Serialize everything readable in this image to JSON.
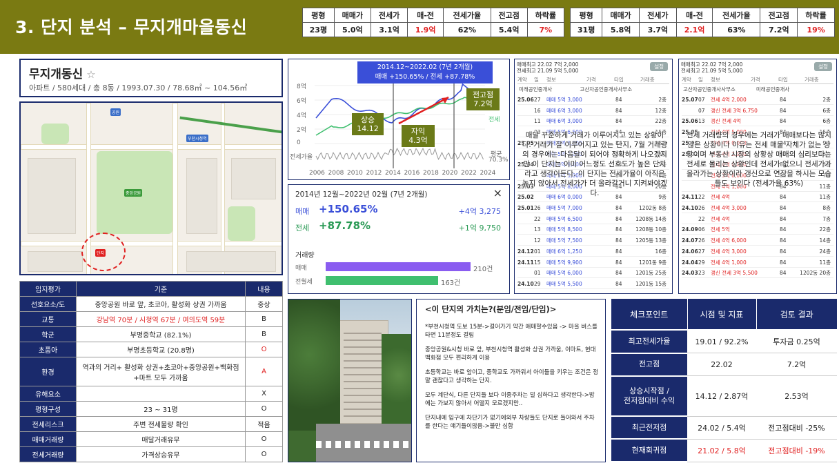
{
  "header": {
    "title": "3. 단지 분석 – 무지개마을동신"
  },
  "pyeong_tables": [
    {
      "headers": [
        "평형",
        "매매가",
        "전세가",
        "매-전",
        "전세가율",
        "전고점",
        "하락률"
      ],
      "values": [
        "23평",
        "5.0억",
        "3.1억",
        "1.9억",
        "62%",
        "5.4억",
        "7%"
      ]
    },
    {
      "headers": [
        "평형",
        "매매가",
        "전세가",
        "매-전",
        "전세가율",
        "전고점",
        "하락률"
      ],
      "values": [
        "31평",
        "5.8억",
        "3.7억",
        "2.1억",
        "63%",
        "7.2억",
        "19%"
      ]
    }
  ],
  "complex": {
    "name": "무지개동신",
    "star": "☆",
    "info": "아파트 / 580세대 / 총 8동 / 1993.07.30 / 78.68㎡ ~ 104.56㎡"
  },
  "evaluation": {
    "headers": [
      "입지평가",
      "기준",
      "내용"
    ],
    "rows": [
      {
        "k": "선호요소/도",
        "v": "중앙공원 바로 앞, 초코아, 활성화 상권 가까움",
        "r": "중상",
        "red": false
      },
      {
        "k": "교통",
        "v": "강남역 70분 / 시청역 67분 / 여의도역 59분",
        "r": "B",
        "red": true
      },
      {
        "k": "학군",
        "v": "부명중학교 (82.1%)",
        "r": "B",
        "red": false
      },
      {
        "k": "초품아",
        "v": "부명초등학교 (20.8명)",
        "r": "O",
        "red": false,
        "rred": true
      },
      {
        "k": "환경",
        "v": "역과의 거리+ 활성화 상권+초코아+중앙공원+백화점+마트 모두 가까움",
        "r": "A",
        "red": false,
        "rred": true
      },
      {
        "k": "유해요소",
        "v": "",
        "r": "X",
        "red": false
      },
      {
        "k": "평형구성",
        "v": "23 ~ 31평",
        "r": "O",
        "red": false
      },
      {
        "k": "전세리스크",
        "v": "주변 전세물량 확인",
        "r": "적음",
        "red": false
      },
      {
        "k": "매매거래량",
        "v": "매달거래유무",
        "r": "O",
        "red": false
      },
      {
        "k": "전세거래량",
        "v": "가격상승유무",
        "r": "O",
        "red": false
      }
    ]
  },
  "price_chart": {
    "period_label": "2014.12~2022.02 (7년 2개월)",
    "change_label": "매매 +150.65% / 전세 +87.78%",
    "y_ticks": [
      "8억",
      "6억",
      "4억",
      "2억",
      "0"
    ],
    "x_ticks": [
      "2006",
      "2008",
      "2010",
      "2012",
      "2014",
      "2016",
      "2018",
      "2020",
      "2022",
      "2024"
    ],
    "jeonse_rate_label": "전세가율",
    "legend_sale": "매매",
    "legend_jeonse": "전세",
    "avg_label": "평균",
    "avg_value": "70.3%",
    "tags": {
      "rise": "상승\n14.12",
      "gap": "자익\n4.3억",
      "peak": "전고점\n7.2억"
    }
  },
  "summary": {
    "period": "2014년 12월~2022년 02월 (7년 2개월)",
    "close_icon": "×",
    "sale_label": "매매",
    "sale_pct": "+150.65%",
    "sale_amt": "+4억 3,275",
    "jeonse_label": "전세",
    "jeonse_pct": "+87.78%",
    "jeonse_amt": "+1억 9,750",
    "volume_title": "거래량",
    "vol": [
      {
        "label": "매매",
        "value": "210건",
        "ratio": 1.0,
        "color": "#8a5cf0"
      },
      {
        "label": "전월세",
        "value": "163건",
        "ratio": 0.776,
        "color": "#3fbf6f"
      }
    ]
  },
  "listing1": {
    "top1": "매매최고 22.02 7억 2,000",
    "top2": "전세최고 21.09 5억 5,000",
    "btn": "설정",
    "cols": [
      "계약",
      "일",
      "정보",
      "가격",
      "타입",
      "거래층"
    ],
    "agents": [
      "미래공인중개사",
      "고산자공인중개사사무소"
    ],
    "rows": [
      [
        "25.06",
        "27",
        "매매 5억 3,000",
        "84",
        "2층"
      ],
      [
        "",
        "16",
        "매매 6억 3,000",
        "84",
        "12층"
      ],
      [
        "",
        "11",
        "매매 6억 3,000",
        "84",
        "22층"
      ],
      [
        "",
        "03",
        "매매 5억 6,500",
        "84",
        "15층"
      ],
      [
        "25.05",
        "",
        "매매 5억 8,000",
        "84",
        "15층"
      ],
      [
        "",
        "",
        "매매 5억 7,000",
        "84",
        "13층"
      ],
      [
        "25.04",
        "",
        "매매 4억 9,000",
        "84",
        "5층"
      ],
      [
        "",
        "",
        "매매 5억 5,000",
        "84",
        "8층"
      ],
      [
        "25.03",
        "",
        "매매 5억 8,000",
        "84",
        "20층"
      ],
      [
        "25.02",
        "",
        "매매 6억 0,000",
        "84",
        "9층"
      ],
      [
        "25.01",
        "26",
        "매매 5억 7,000",
        "84",
        "1202동 8층"
      ],
      [
        "",
        "22",
        "매매 5억 6,500",
        "84",
        "1208동 14층"
      ],
      [
        "",
        "13",
        "매매 5억 8,500",
        "84",
        "1208동 10층"
      ],
      [
        "",
        "12",
        "매매 5억 7,500",
        "84",
        "1205동 13층"
      ],
      [
        "24.12",
        "01",
        "매매 6억 1,250",
        "84",
        "16층"
      ],
      [
        "24.11",
        "15",
        "매매 5억 9,900",
        "84",
        "1201동 9층"
      ],
      [
        "",
        "01",
        "매매 5억 6,000",
        "84",
        "1201동 25층"
      ],
      [
        "24.10",
        "29",
        "매매 5억 5,500",
        "84",
        "1201동 15층"
      ]
    ],
    "overlay": "매달 꾸준하게 거래가 이루어지고 있는 상황이다. 거래가 잘 이루어지고 있는 단지, 7월 거래량의 경우에는 다음달이 되어야 정확하게 나오겠지만 이 단지는 이미 어느정도 선호도가 높은 단지라고 생각이든다. 이 단지는 전세가율이 아직은 높지 않아서 전세가가 더 올라갈거니 지켜봐야겠다."
  },
  "listing2": {
    "top1": "매매최고 22.02 7억 2,000",
    "top2": "전세최고 21.09 5억 5,000",
    "btn": "설정",
    "cols": [
      "계약",
      "일",
      "정보",
      "가격",
      "타입",
      "거래층"
    ],
    "agents": [
      "고산자공인중개사사무소",
      "미래공인중개사"
    ],
    "rows": [
      [
        "25.07",
        "07",
        "전세 4억 2,000",
        "84",
        "2층"
      ],
      [
        "",
        "07",
        "갱신 전세 3억 6,750",
        "84",
        "6층"
      ],
      [
        "25.06",
        "13",
        "갱신 전세 4억",
        "84",
        "6층"
      ],
      [
        "25.05",
        "",
        "전세 4억 5,000",
        "84",
        "15층"
      ],
      [
        "25.03",
        "",
        "전세 4억 0,000",
        "84",
        "9층"
      ],
      [
        "25.02",
        "",
        "전세 4억 2,000",
        "84",
        "12층"
      ],
      [
        "",
        "",
        "전세 4억 0,000",
        "84",
        "3층"
      ],
      [
        "",
        "",
        "전세 3억 8,000",
        "84",
        "7층"
      ],
      [
        "",
        "",
        "전세 4억 1,000",
        "84",
        "11층"
      ],
      [
        "24.11",
        "22",
        "전세 4억",
        "84",
        "11층"
      ],
      [
        "24.10",
        "26",
        "전세 4억 3,000",
        "84",
        "8층"
      ],
      [
        "",
        "22",
        "전세 4억",
        "84",
        "7층"
      ],
      [
        "24.09",
        "06",
        "전세 5억",
        "84",
        "22층"
      ],
      [
        "24.07",
        "26",
        "전세 4억 6,000",
        "84",
        "14층"
      ],
      [
        "24.06",
        "27",
        "전세 4억 3,000",
        "84",
        "24층"
      ],
      [
        "24.04",
        "29",
        "전세 4억 1,000",
        "84",
        "11층"
      ],
      [
        "24.03",
        "23",
        "갱신 전세 3억 5,500",
        "84",
        "1202동 20층"
      ]
    ],
    "overlay": "전세 거래량의 경우에는 거래가 매매보다는 많지 않은 상황이다 이유는 전세 매물 자체가 없는 상황이며 부동산 시장의 상황상 매매의 심리보다는 전세로 몰리는 상황인데 전세가 없으니 전세가가 올라가는 상황이라 갱신으로 연장을 하시는 모습들도 보인다 (전세가율 63%)"
  },
  "value_box": {
    "title": "<이 단지의 가치는?(분임/전임/단임)>",
    "paras": [
      "*부천시청역 도보 15분->걸어가기 약간 애매할수있음 -> 마을 버스를 타면 11분정도 걸림",
      "중앙공원&시청 바로 앞, 부천시청역 활성화 상권 가까움, 이마트, 현대백화점 모두 편리하게 이용",
      "초등학교는 바로 앞이고, 중학교도 가까워서 아이들을 키우는 조건은 정말 괜찮다고 생각하는 단지.",
      "모두 계단식, 다른 단지들 보다 이중주차는 덜 심하다고 생각한다->밤에는 가보지 않아서 어떨지 모르겠지만..",
      "단지내에 입구에 차단기가 없기에외부 차량들도 단지로 들어와서 주차를 한다는 얘기들이많음->불만 심함"
    ]
  },
  "checkpoints": {
    "headers": [
      "체크포인트",
      "시점 및 지표",
      "검토 결과"
    ],
    "rows": [
      {
        "k": "최고전세가율",
        "v": "19.01 / 92.2%",
        "r": "투자금 0.25억",
        "red": false
      },
      {
        "k": "전고점",
        "v": "22.02",
        "r": "7.2억",
        "red": false
      },
      {
        "k": "상승시작점 /\n전저점대비 수익",
        "v": "14.12 / 2.87억",
        "r": "2.53억",
        "red": false
      },
      {
        "k": "최근전저점",
        "v": "24.02 / 5.4억",
        "r": "전고점대비 -25%",
        "red": false
      },
      {
        "k": "현재회귀점",
        "v": "21.02 / 5.8억",
        "r": "전고점대비 -19%",
        "red": true
      }
    ]
  },
  "map_labels": [
    "공원",
    "부천시청역",
    "중앙공원",
    "단지"
  ],
  "colors": {
    "header": "#7a7a12",
    "navy": "#1a2a6c",
    "red": "#e02020",
    "sale": "#8a5cf0",
    "jeonse": "#3fbf6f"
  }
}
